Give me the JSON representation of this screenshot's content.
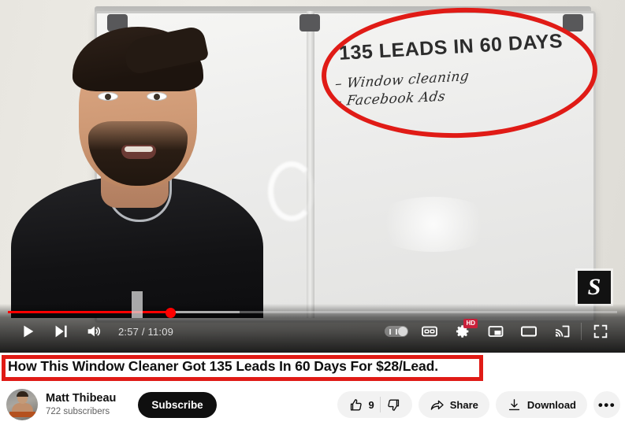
{
  "player": {
    "progress": {
      "current_time": "2:57",
      "duration": "11:09",
      "time_display": "2:57 / 11:09",
      "played_percent": 26.6,
      "buffered_percent": 38,
      "accent_color": "#ff0000"
    },
    "left_controls": [
      {
        "name": "play-button",
        "icon": "play-icon",
        "label": "Play"
      },
      {
        "name": "next-button",
        "icon": "next-icon",
        "label": "Next"
      },
      {
        "name": "volume-button",
        "icon": "volume-icon",
        "label": "Mute"
      }
    ],
    "right_controls": [
      {
        "name": "autoplay-toggle",
        "icon": "autoplay-icon",
        "label": "Autoplay is off"
      },
      {
        "name": "subtitles-button",
        "icon": "cc-icon",
        "label": "Subtitles"
      },
      {
        "name": "settings-button",
        "icon": "gear-icon",
        "label": "Settings",
        "badge": "HD"
      },
      {
        "name": "miniplayer-button",
        "icon": "miniplayer-icon",
        "label": "Miniplayer"
      },
      {
        "name": "theater-button",
        "icon": "theater-icon",
        "label": "Theater mode"
      },
      {
        "name": "cast-button",
        "icon": "cast-icon",
        "label": "Play on TV"
      },
      {
        "name": "fullscreen-button",
        "icon": "fullscreen-icon",
        "label": "Full screen"
      }
    ],
    "watermark": {
      "text": "S",
      "name": "channel-watermark"
    },
    "whiteboard": {
      "heading": "135 LEADS IN 60 DAYS",
      "bullet_1": "– Window cleaning",
      "bullet_2": "– Facebook Ads"
    },
    "annotations": {
      "ellipse_color": "#e01b16",
      "box_color": "#e01b16"
    }
  },
  "video": {
    "title": "How This Window Cleaner Got 135 Leads In 60 Days For $28/Lead."
  },
  "channel": {
    "name": "Matt Thibeau",
    "subscribers": "722 subscribers",
    "subscribe_label": "Subscribe",
    "avatar_name": "channel-avatar"
  },
  "actions": {
    "like_count": "9",
    "like_label": "Like",
    "dislike_label": "Dislike",
    "share_label": "Share",
    "download_label": "Download",
    "more_label": "•••"
  }
}
